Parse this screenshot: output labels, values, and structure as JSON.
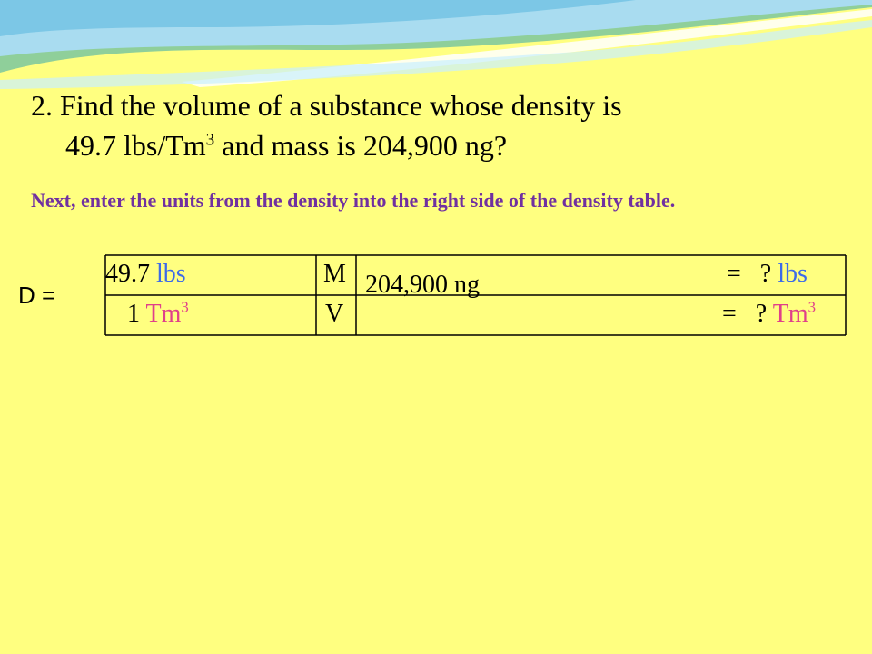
{
  "problem": {
    "line1": "2.  Find the volume of a substance whose density is",
    "line2_prefix": "49.7 lbs/Tm",
    "line2_exp": "3",
    "line2_suffix": "  and mass is 204,900 ng?"
  },
  "instruction": "Next, enter the units from the density into the right side of the density table.",
  "d_label": "D =",
  "table": {
    "density_top_value": "49.7",
    "density_top_unit": "lbs",
    "density_bottom_value": "1",
    "density_bottom_unit": "Tm",
    "density_bottom_exp": "3",
    "m_label": "M",
    "v_label": "V",
    "mass_value": "204,900 ng",
    "mass_result_prefix": "=   ?",
    "mass_result_unit": "lbs",
    "volume_result_prefix": "=   ?",
    "volume_result_unit": "Tm",
    "volume_result_exp": "3"
  },
  "colors": {
    "background": "#ffff80",
    "instruction": "#7030a0",
    "lbs_unit": "#3d6be8",
    "tm_unit": "#e0408a"
  }
}
